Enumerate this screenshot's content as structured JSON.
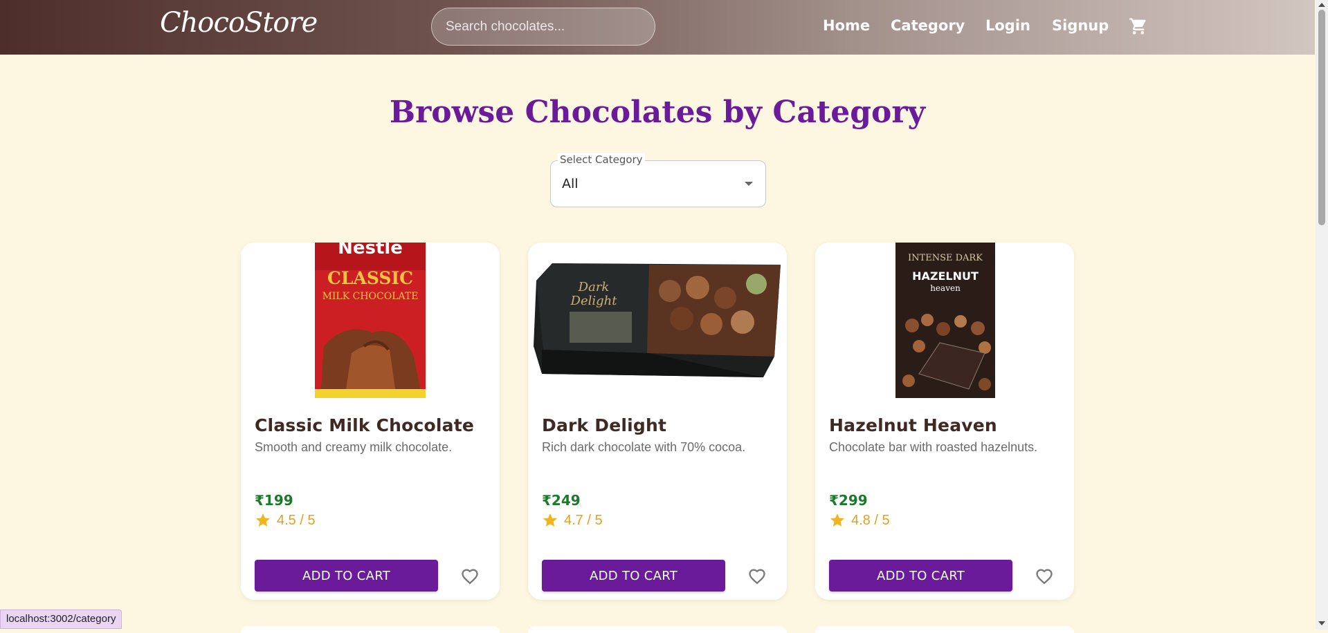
{
  "navbar": {
    "logo": "ChocoStore",
    "search_placeholder": "Search chocolates...",
    "links": [
      "Home",
      "Category",
      "Login",
      "Signup"
    ],
    "cart_icon": "shopping-cart-icon"
  },
  "page": {
    "title": "Browse Chocolates by Category",
    "select": {
      "label": "Select Category",
      "value": "All"
    }
  },
  "products": [
    {
      "name": "Classic Milk Chocolate",
      "description": "Smooth and creamy milk chocolate.",
      "price": "₹199",
      "rating": "4.5 / 5",
      "button": "ADD TO CART",
      "image_text": {
        "brand": "Nestlé",
        "line1": "CLASSIC",
        "line2": "MILK CHOCOLATE"
      }
    },
    {
      "name": "Dark Delight",
      "description": "Rich dark chocolate with 70% cocoa.",
      "price": "₹249",
      "rating": "4.7 / 5",
      "button": "ADD TO CART",
      "image_text": {
        "line1": "Dark",
        "line2": "Delight"
      }
    },
    {
      "name": "Hazelnut Heaven",
      "description": "Chocolate bar with roasted hazelnuts.",
      "price": "₹299",
      "rating": "4.8 / 5",
      "button": "ADD TO CART",
      "image_text": {
        "line1": "INTENSE DARK",
        "line2": "HAZELNUT",
        "line3": "heaven"
      }
    }
  ],
  "status_bar": {
    "url": "localhost:3002/category"
  },
  "colors": {
    "accent": "#6a1b9a",
    "price": "#1b7a2a",
    "rating": "#e0a020",
    "background": "#fdf7e1",
    "title_text": "#3e2a23"
  }
}
